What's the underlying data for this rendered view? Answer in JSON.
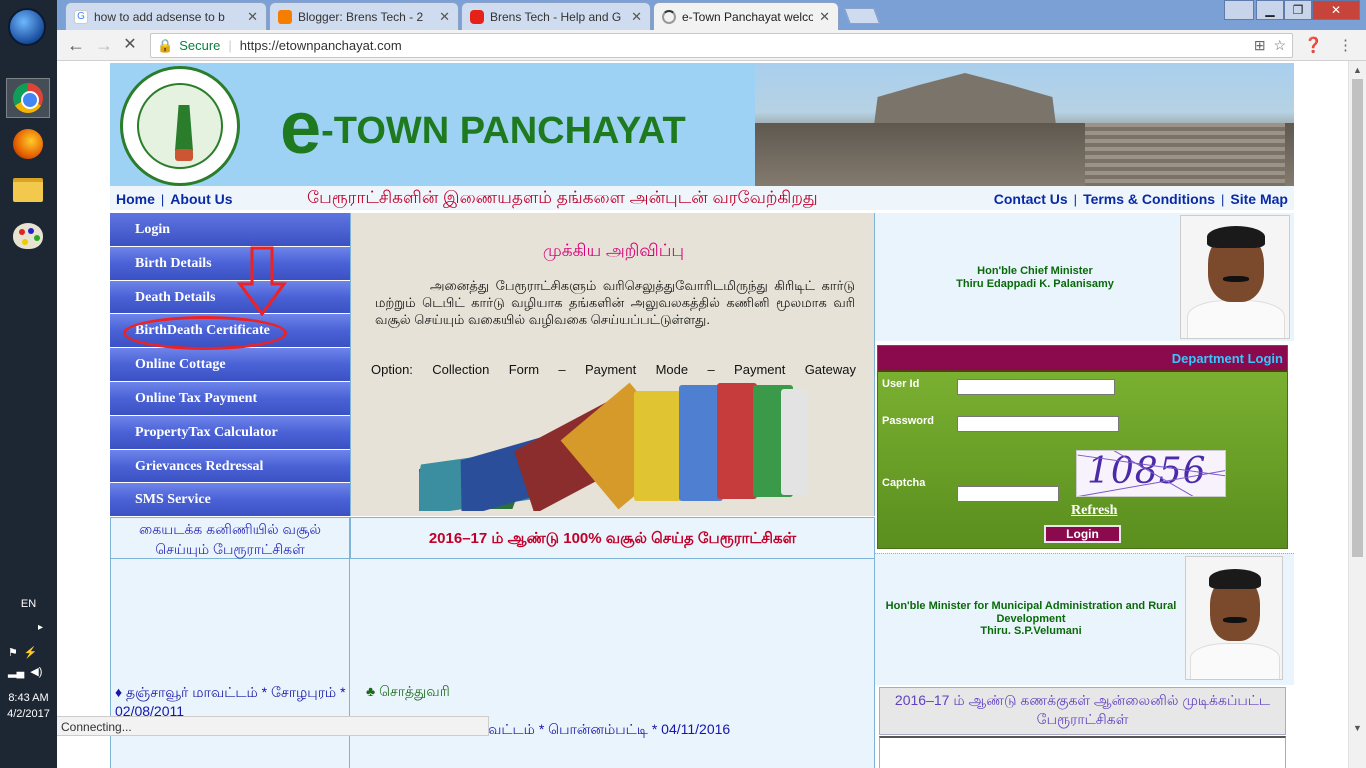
{
  "taskbar": {
    "language": "EN",
    "time": "8:43 AM",
    "date": "4/2/2017",
    "apps": [
      "chrome-icon",
      "firefox-icon",
      "file-explorer-icon",
      "paint-icon"
    ]
  },
  "browser": {
    "tabs": [
      {
        "title": "how to add adsense to b",
        "favicon": "google-icon",
        "active": false
      },
      {
        "title": "Blogger: Brens Tech - 2",
        "favicon": "blogger-icon",
        "active": false
      },
      {
        "title": "Brens Tech - Help and G",
        "favicon": "youtube-icon",
        "active": false
      },
      {
        "title": "e-Town Panchayat welco",
        "favicon": "loading-icon",
        "active": true
      }
    ],
    "secure_label": "Secure",
    "url": "https://etownpanchayat.com",
    "status": "Connecting..."
  },
  "site": {
    "logo_e": "e",
    "logo_rest": "-TOWN PANCHAYAT",
    "nav": {
      "home": "Home",
      "about": "About Us",
      "welcome": "பேரூராட்சிகளின் இணையதளம் தங்களை அன்புடன் வரவேற்கிறது",
      "contact": "Contact Us",
      "terms": "Terms & Conditions",
      "sitemap": "Site Map"
    },
    "menu": [
      "Login",
      "Birth Details",
      "Death Details",
      "BirthDeath Certificate",
      "Online Cottage",
      "Online Tax Payment",
      "PropertyTax Calculator",
      "Grievances Redressal",
      "SMS Service"
    ],
    "menu_caption": "கையடக்க கனிணியில் வசூல் செய்யும் பேரூராட்சிகள்",
    "notice": {
      "heading": "முக்கிய அறிவிப்பு",
      "body": "அனைத்து பேரூராட்சிகளும் வரிசெலுத்துவோரிடமிருந்து கிரிடிட் கார்டு மற்றும் டெபிட் கார்டு வழியாக தங்களின் அலுவலகத்தில் கணினி மூலமாக வரி வசூல் செய்யும் வகையில் வழிவகை செய்யப்பட்டுள்ளது.",
      "option": "Option: Collection Form – Payment Mode – Payment Gateway"
    },
    "center_caption": "2016–17 ம் ஆண்டு 100% வசூல் செய்த பேரூராட்சிகள்",
    "lower_left_item": "♦ தஞ்சாவூர் மாவட்டம் * சோழபுரம் * 02/08/2011",
    "lower_center_item1": "♣ சொத்துவரி",
    "lower_center_item2": "வட்டம் * பொன்னம்பட்டி * 04/11/2016",
    "cm": {
      "title": "Hon'ble Chief Minister",
      "name": "Thiru Edappadi K. Palanisamy"
    },
    "login": {
      "header": "Department Login",
      "userid_label": "User Id",
      "password_label": "Password",
      "captcha_label": "Captcha",
      "captcha_value": "10856",
      "refresh": "Refresh",
      "button": "Login"
    },
    "minister": {
      "title": "Hon'ble Minister for Municipal Administration and Rural Development",
      "name": "Thiru. S.P.Velumani"
    },
    "accounts_caption": "2016–17 ம் ஆண்டு கணக்குகள் ஆன்லைனில் முடிக்கப்பட்ட பேரூராட்சிகள்"
  },
  "colors": {
    "header_bg": "#9ed2f5",
    "menu_blue": "#4a62d6",
    "login_green": "#6aa028",
    "login_header": "#8a0a4d",
    "annotation_red": "#e22222"
  }
}
